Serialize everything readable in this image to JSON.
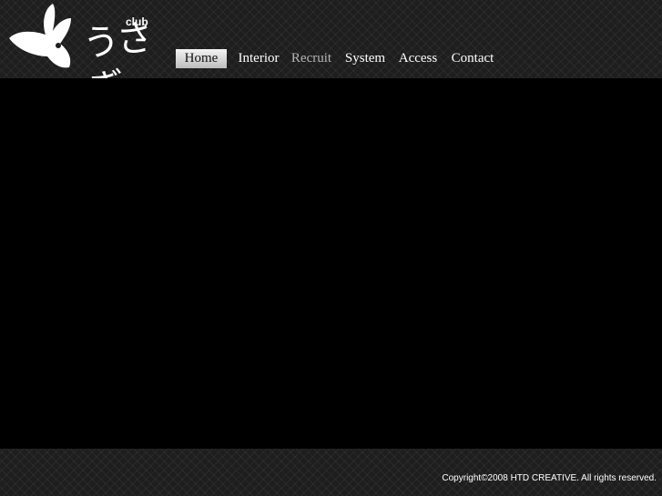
{
  "logo": {
    "club": "club",
    "kana": "うさぎ",
    "icon": "rabbit-icon"
  },
  "nav": {
    "items": [
      {
        "label": "Home",
        "state": "active"
      },
      {
        "label": "Interior",
        "state": "normal"
      },
      {
        "label": "Recruit",
        "state": "muted"
      },
      {
        "label": "System",
        "state": "normal"
      },
      {
        "label": "Access",
        "state": "normal"
      },
      {
        "label": "Contact",
        "state": "normal"
      }
    ]
  },
  "footer": {
    "copyright": "Copyright©2008 HTD CREATIVE. All rights reserved."
  }
}
